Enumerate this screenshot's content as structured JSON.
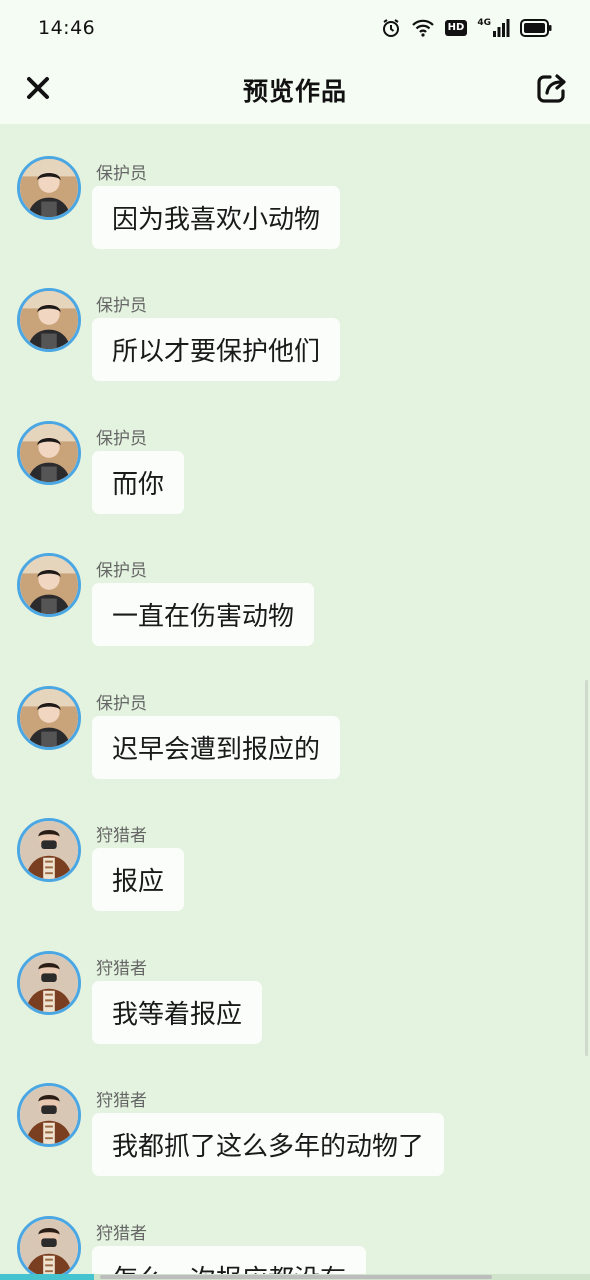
{
  "status_bar": {
    "time": "14:46",
    "icons": [
      "alarm-icon",
      "wifi-icon",
      "hd-badge",
      "signal-4g-icon",
      "battery-icon"
    ],
    "hd_label": "HD",
    "network_label": "4G"
  },
  "header": {
    "title": "预览作品",
    "close_icon": "close-icon",
    "share_icon": "share-icon"
  },
  "colors": {
    "background": "#e3f3df",
    "header_background": "#f5fcf3",
    "bubble": "#fbfdfb",
    "avatar_ring": "#4aa7e3",
    "progress": "#45c3cf"
  },
  "messages": [
    {
      "sender": "保护员",
      "avatar": "guardian-avatar",
      "text": "因为我喜欢小动物"
    },
    {
      "sender": "保护员",
      "avatar": "guardian-avatar",
      "text": "所以才要保护他们"
    },
    {
      "sender": "保护员",
      "avatar": "guardian-avatar",
      "text": "而你"
    },
    {
      "sender": "保护员",
      "avatar": "guardian-avatar",
      "text": "一直在伤害动物"
    },
    {
      "sender": "保护员",
      "avatar": "guardian-avatar",
      "text": "迟早会遭到报应的"
    },
    {
      "sender": "狩猎者",
      "avatar": "hunter-avatar",
      "text": "报应"
    },
    {
      "sender": "狩猎者",
      "avatar": "hunter-avatar",
      "text": "我等着报应"
    },
    {
      "sender": "狩猎者",
      "avatar": "hunter-avatar",
      "text": "我都抓了这么多年的动物了"
    },
    {
      "sender": "狩猎者",
      "avatar": "hunter-avatar",
      "text": "怎么一次报应都没有"
    }
  ],
  "playback": {
    "progress_fraction": 0.16
  }
}
